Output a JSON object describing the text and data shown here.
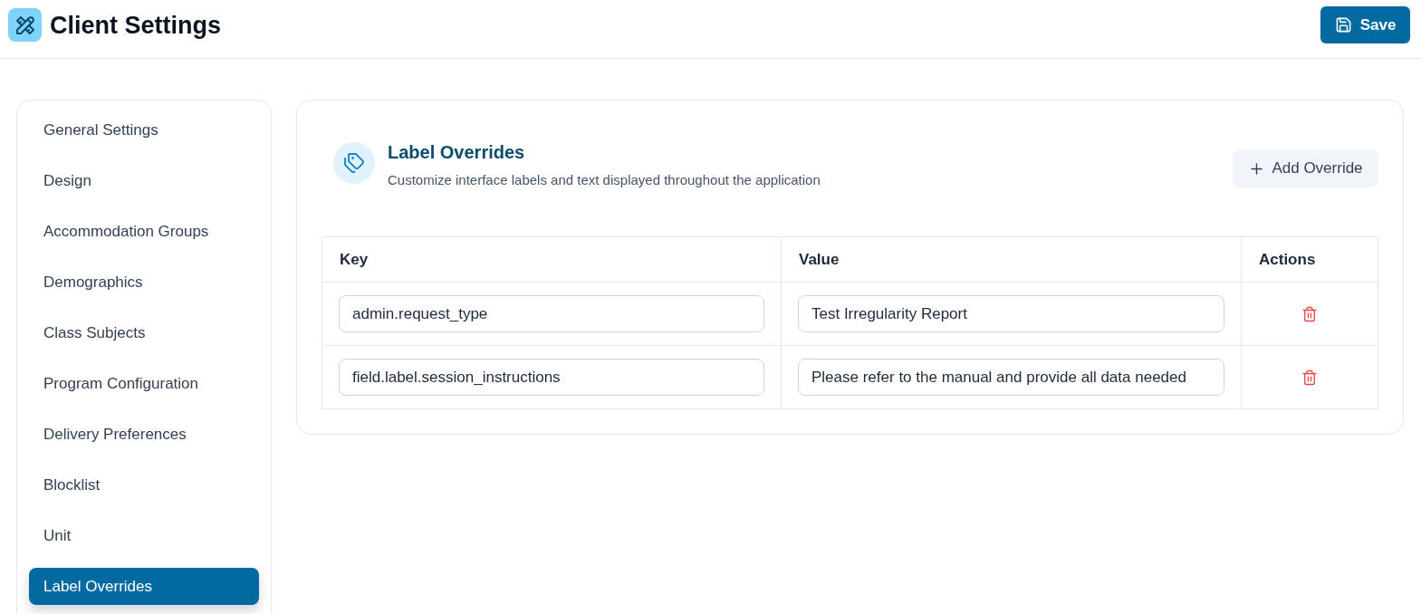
{
  "header": {
    "title": "Client Settings",
    "save_button": "Save"
  },
  "sidebar": {
    "items": [
      {
        "label": "General Settings",
        "selected": false
      },
      {
        "label": "Design",
        "selected": false
      },
      {
        "label": "Accommodation Groups",
        "selected": false
      },
      {
        "label": "Demographics",
        "selected": false
      },
      {
        "label": "Class Subjects",
        "selected": false
      },
      {
        "label": "Program Configuration",
        "selected": false
      },
      {
        "label": "Delivery Preferences",
        "selected": false
      },
      {
        "label": "Blocklist",
        "selected": false
      },
      {
        "label": "Unit",
        "selected": false
      },
      {
        "label": "Label Overrides",
        "selected": true
      }
    ]
  },
  "panel": {
    "title": "Label Overrides",
    "subtitle": "Customize interface labels and text displayed throughout the application",
    "add_button": "Add Override",
    "table": {
      "columns": [
        "Key",
        "Value",
        "Actions"
      ],
      "rows": [
        {
          "key": "admin.request_type",
          "value": "Test Irregularity Report"
        },
        {
          "key": "field.label.session_instructions",
          "value": "Please refer to the manual and provide all data needed"
        }
      ]
    }
  }
}
